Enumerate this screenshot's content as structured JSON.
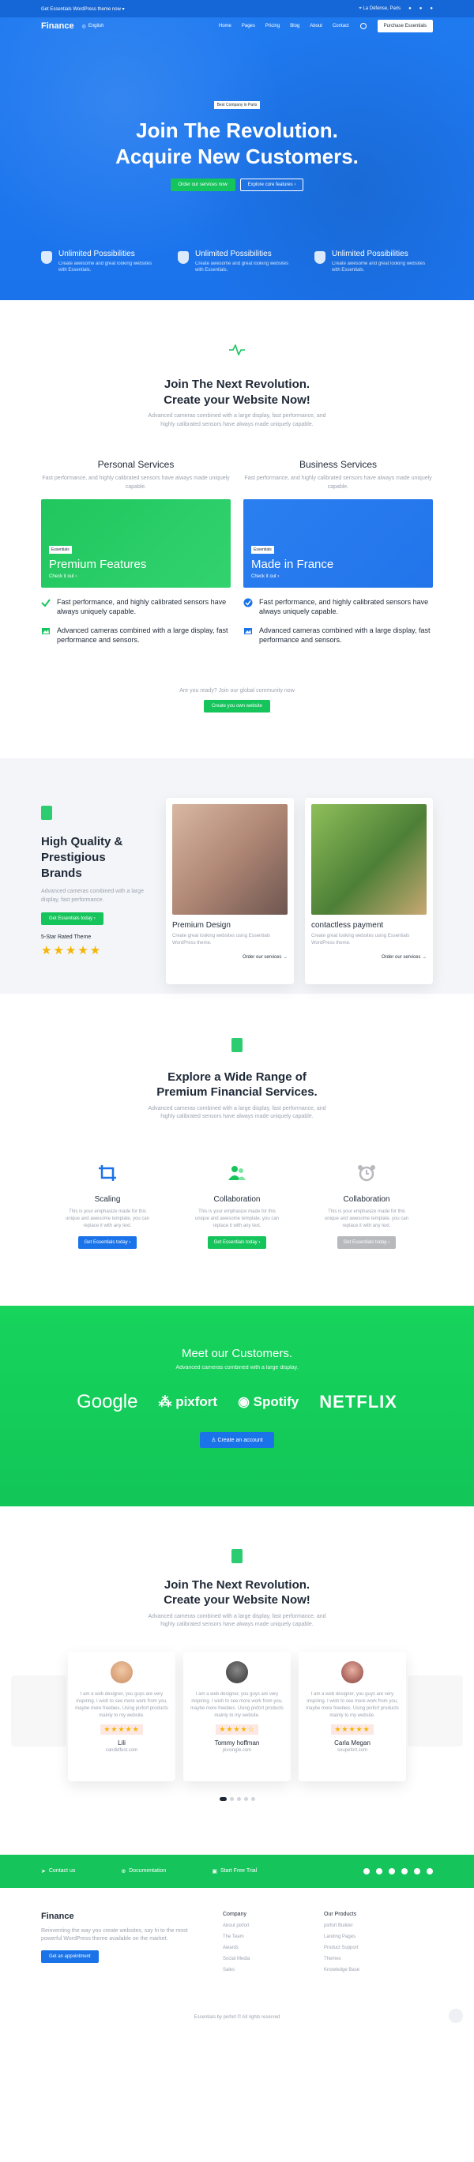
{
  "topbar": {
    "promo": "Get Essentials WordPress theme now ▾",
    "location": "La Défense, Paris"
  },
  "header": {
    "logo": "Finance",
    "language": "English",
    "nav": [
      "Home",
      "Pages",
      "Pricing",
      "Blog",
      "About",
      "Contact"
    ],
    "cta": "Purchase Essentials"
  },
  "hero": {
    "badge": "Best Company in Paris",
    "title_line1": "Join The Revolution.",
    "title_line2": "Acquire New Customers.",
    "btn_primary": "Order our services now",
    "btn_secondary": "Explore core features ›",
    "features": [
      {
        "title": "Unlimited Possibilities",
        "desc": "Create awesome and great looking websites with Essentials."
      },
      {
        "title": "Unlimited Possibilities",
        "desc": "Create awesome and great looking websites with Essentials."
      },
      {
        "title": "Unlimited Possibilities",
        "desc": "Create awesome and great looking websites with Essentials."
      }
    ]
  },
  "intro": {
    "title_line1": "Join The Next Revolution.",
    "title_line2": "Create your Website Now!",
    "desc": "Advanced cameras combined with a large display, fast performance, and highly calibrated sensors have always made uniquely capable."
  },
  "services": [
    {
      "title": "Personal Services",
      "desc": "Fast performance, and highly calibrated sensors have always made uniquely capable.",
      "tag": "Essentials",
      "card_title": "Premium Features",
      "card_link": "Check it out ›",
      "points": [
        "Fast performance, and highly calibrated sensors have always uniquely capable.",
        "Advanced cameras combined with a large display, fast performance and sensors."
      ]
    },
    {
      "title": "Business Services",
      "desc": "Fast performance, and highly calibrated sensors have always made uniquely capable.",
      "tag": "Essentials",
      "card_title": "Made in France",
      "card_link": "Check it out ›",
      "points": [
        "Fast performance, and highly calibrated sensors have always uniquely capable.",
        "Advanced cameras combined with a large display, fast performance and sensors."
      ]
    }
  ],
  "ready": {
    "text": "Are you ready? Join our global community now",
    "button": "Create you own website"
  },
  "brands": {
    "title_line1": "High Quality &",
    "title_line2": "Prestigious Brands",
    "desc": "Advanced cameras combined with a large display, fast performance.",
    "button": "Get Essentials today ›",
    "rating_label": "5-Star Rated Theme",
    "stars": "★★★★★",
    "cards": [
      {
        "title": "Premium Design",
        "desc": "Create great looking websites using Essentials WordPress theme.",
        "link": "Order our services →"
      },
      {
        "title": "contactless payment",
        "desc": "Create great looking websites using Essentials WordPress theme.",
        "link": "Order our services →"
      }
    ]
  },
  "explore": {
    "title_line1": "Explore a Wide Range of",
    "title_line2": "Premium Financial Services.",
    "desc": "Advanced cameras combined with a large display, fast performance, and highly calibrated sensors have always made uniquely capable.",
    "items": [
      {
        "title": "Scaling",
        "desc": "This is your emphasize made for this unique and awesome template, you can replace it with any text.",
        "button": "Get Essentials today ›",
        "color": "#1a73e8"
      },
      {
        "title": "Collaboration",
        "desc": "This is your emphasize made for this unique and awesome template, you can replace it with any text.",
        "button": "Get Essentials today ›",
        "color": "#16c45c"
      },
      {
        "title": "Collaboration",
        "desc": "This is your emphasize made for this unique and awesome template, you can replace it with any text.",
        "button": "Get Essentials today ›",
        "color": "#b7b9bd"
      }
    ]
  },
  "customers": {
    "title": "Meet our Customers.",
    "desc": "Advanced cameras combined with a large display.",
    "logos": [
      "Google",
      "pixfort",
      "Spotify",
      "NETFLIX"
    ],
    "button": "Create an account"
  },
  "testimonials": {
    "title_line1": "Join The Next Revolution.",
    "title_line2": "Create your Website Now!",
    "desc": "Advanced cameras combined with a large display, fast performance, and highly calibrated sensors have always made uniquely capable.",
    "items": [
      {
        "quote": "I am a web designer, you guys are very inspiring. I wish to see more work from you, maybe more freebies. Using pixfort products mainly to my website.",
        "stars": "★★★★★",
        "name": "Lili",
        "site": "candidfest.com"
      },
      {
        "quote": "I am a web designer, you guys are very inspiring. I wish to see more work from you, maybe more freebies. Using pixfort products mainly to my website.",
        "stars": "★★★★☆",
        "name": "Tommy hoffman",
        "site": "pixsingle.com"
      },
      {
        "quote": "I am a web designer, you guys are very inspiring. I wish to see more work from you, maybe more freebies. Using pixfort products mainly to my website.",
        "stars": "★★★★★",
        "name": "Carla Megan",
        "site": "soupefort.com"
      }
    ]
  },
  "greenbar": {
    "contact": "Contact us",
    "documentation": "Documentation",
    "trial": "Start Free Trial"
  },
  "footer": {
    "logo": "Finance",
    "desc": "Reinventing the way you create websites, say hi to the most powerful WordPress theme available on the market.",
    "button": "Get an appointment",
    "col1_title": "Company",
    "col1": [
      "About pixfort",
      "The Team",
      "Awards",
      "Social Media",
      "Sales"
    ],
    "col2_title": "Our Products",
    "col2": [
      "pixfort Builder",
      "Landing Pages",
      "Product Support",
      "Themes",
      "Knowledge Base"
    ],
    "copyright": "Essentials by pixfort © All rights reserved"
  },
  "colors": {
    "blue": "#1a73e8",
    "green": "#16c45c"
  }
}
